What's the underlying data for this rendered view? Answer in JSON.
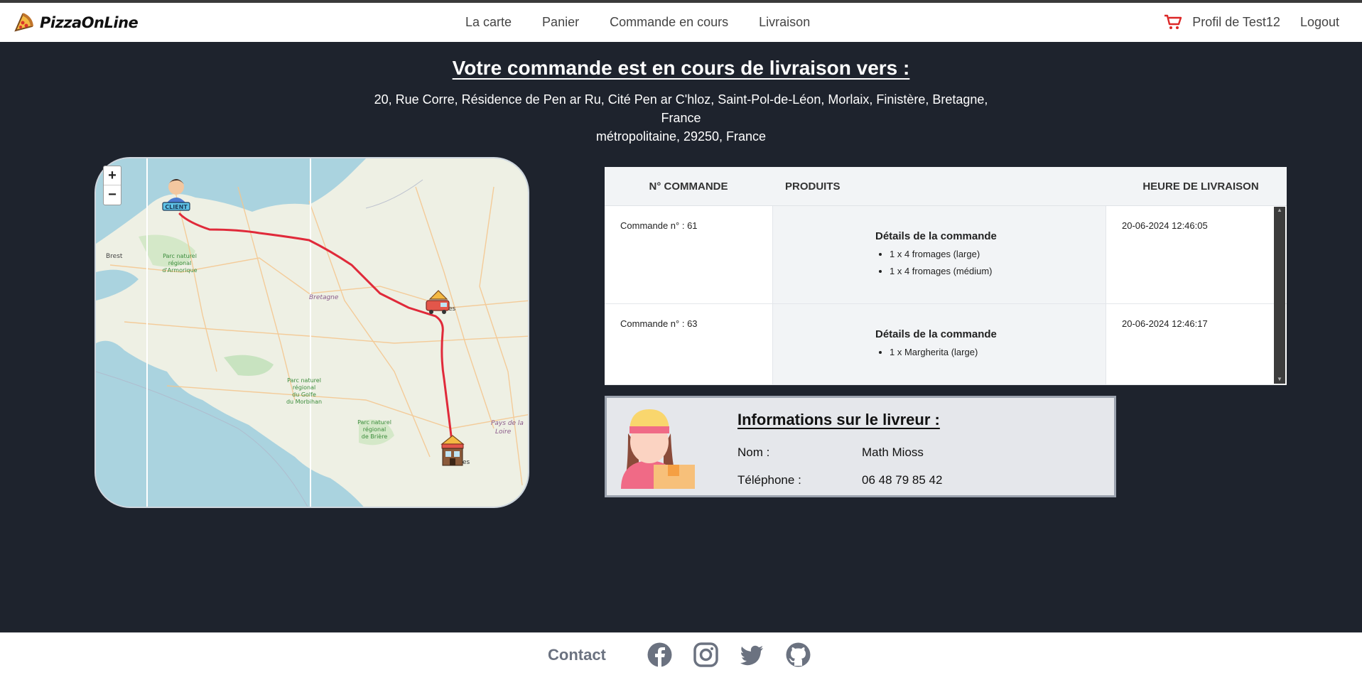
{
  "navbar": {
    "brand": "PizzaOnLine",
    "links": [
      "La carte",
      "Panier",
      "Commande en cours",
      "Livraison"
    ],
    "profile": "Profil de Test12",
    "logout": "Logout"
  },
  "hero": {
    "title": "Votre commande est en cours de livraison vers :",
    "address_line1": "20, Rue Corre, Résidence de Pen ar Ru, Cité Pen ar C'hloz, Saint-Pol-de-Léon, Morlaix, Finistère, Bretagne, France",
    "address_line2": "métropolitaine, 29250, France"
  },
  "map": {
    "zoom_in": "+",
    "zoom_out": "−",
    "client_marker": "CLIENT",
    "labels": {
      "brest": "Brest",
      "bretagne": "Bretagne",
      "parc_armorique": [
        "Parc naturel",
        "régional",
        "d'Armorique"
      ],
      "parc_morbihan": [
        "Parc naturel",
        "régional",
        "du Golfe",
        "du Morbihan"
      ],
      "parc_briere": [
        "Parc naturel",
        "régional",
        "de Brière"
      ],
      "pays_loire": [
        "Pays de la",
        "Loire"
      ],
      "rennes_suffix": "es",
      "nantes_suffix": "es"
    },
    "colors": {
      "route": "#e02a3a",
      "sea": "#aad3df",
      "land": "#eef0e4"
    }
  },
  "orders": {
    "headers": [
      "N° COMMANDE",
      "PRODUITS",
      "HEURE DE LIVRAISON"
    ],
    "rows": [
      {
        "order": "Commande n° : 61",
        "details_title": "Détails de la commande",
        "items": [
          "1 x 4 fromages (large)",
          "1 x 4 fromages (médium)"
        ],
        "time": "20-06-2024 12:46:05"
      },
      {
        "order": "Commande n° : 63",
        "details_title": "Détails de la commande",
        "items": [
          "1 x Margherita (large)"
        ],
        "time": "20-06-2024 12:46:17"
      }
    ]
  },
  "courier": {
    "title": "Informations sur le livreur :",
    "name_label": "Nom :",
    "name": "Math Mioss",
    "phone_label": "Téléphone :",
    "phone": "06 48 79 85 42"
  },
  "footer": {
    "contact": "Contact",
    "socials": [
      "facebook-icon",
      "instagram-icon",
      "twitter-icon",
      "github-icon"
    ]
  }
}
